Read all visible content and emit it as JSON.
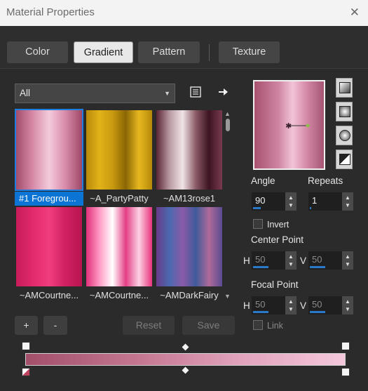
{
  "window": {
    "title": "Material Properties",
    "close_glyph": "✕"
  },
  "tabs": [
    {
      "label": "Color",
      "active": false
    },
    {
      "label": "Gradient",
      "active": true
    },
    {
      "label": "Pattern",
      "active": false
    },
    {
      "label": "Texture",
      "active": false
    }
  ],
  "library": {
    "category": "All",
    "icons": {
      "browse": "list-icon",
      "go": "arrow-right-icon"
    },
    "gradients": [
      {
        "label": "#1 Foregrou...",
        "selected": true,
        "colors": [
          "#a34d6c",
          "#d689a6",
          "#f3cbdb",
          "#d88aa9",
          "#9e4866"
        ]
      },
      {
        "label": "~A_PartyPatty",
        "selected": false,
        "colors": [
          "#b88a0a",
          "#e1b218",
          "#c99a10",
          "#8a6604",
          "#e8b820",
          "#b48808"
        ]
      },
      {
        "label": "~AM13rose1",
        "selected": false,
        "colors": [
          "#5a2333",
          "#b89aa2",
          "#f0e4e6",
          "#8a5a66",
          "#3d1422",
          "#7a3a4e"
        ]
      },
      {
        "label": "~AMCourtne...",
        "selected": false,
        "colors": [
          "#c81c5a",
          "#e02a6c",
          "#f03d7e",
          "#d02062",
          "#b81450"
        ]
      },
      {
        "label": "~AMCourtne...",
        "selected": false,
        "colors": [
          "#e0307a",
          "#ff9ac4",
          "#ffffff",
          "#e43e84",
          "#fbd0e4",
          "#e8347c"
        ]
      },
      {
        "label": "~AMDarkFairy",
        "selected": false,
        "colors": [
          "#6a3a8a",
          "#4a6ab0",
          "#8a5aa8",
          "#3e5a9a",
          "#b06a9a",
          "#5a4a90"
        ]
      }
    ],
    "buttons": {
      "add": "+",
      "remove": "-",
      "reset": "Reset",
      "save": "Save"
    }
  },
  "properties": {
    "style_icons": [
      "linear-style-icon",
      "rectangular-style-icon",
      "sunburst-style-icon",
      "radial-style-icon"
    ],
    "angle_label": "Angle",
    "angle": "90",
    "angle_level": 0.25,
    "repeats_label": "Repeats",
    "repeats": "1",
    "repeats_level": 0.02,
    "invert_label": "Invert",
    "invert_checked": false,
    "center_point_label": "Center Point",
    "center_h_label": "H",
    "center_h": "50",
    "center_h_level": 0.5,
    "center_v_label": "V",
    "center_v": "50",
    "center_v_level": 0.5,
    "focal_point_label": "Focal Point",
    "focal_h_label": "H",
    "focal_h": "50",
    "focal_h_level": 0.5,
    "focal_v_label": "V",
    "focal_v": "50",
    "focal_v_level": 0.5,
    "link_label": "Link",
    "link_checked": false
  },
  "editor": {
    "colors": {
      "start": "#a24f6a",
      "end": "#f4c8db"
    },
    "midpoint": 0.5
  }
}
